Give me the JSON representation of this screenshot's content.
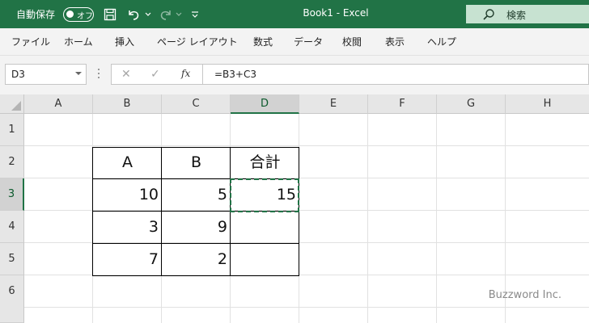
{
  "titlebar": {
    "autosave_label": "自動保存",
    "toggle_text": "オフ",
    "title": "Book1  -  Excel",
    "search_placeholder": "検索",
    "background": "#217346"
  },
  "ribbon": {
    "tabs": [
      "ファイル",
      "ホーム",
      "挿入",
      "ページ レイアウト",
      "数式",
      "データ",
      "校閲",
      "表示",
      "ヘルプ"
    ]
  },
  "formula_bar": {
    "name_box": "D3",
    "fx": "fx",
    "formula": "=B3+C3"
  },
  "grid": {
    "columns": [
      "A",
      "B",
      "C",
      "D",
      "E",
      "F",
      "G",
      "H"
    ],
    "rows": [
      "1",
      "2",
      "3",
      "4",
      "5",
      "6"
    ],
    "active_column": "D",
    "active_row": "3",
    "cells": {
      "B2": "A",
      "C2": "B",
      "D2": "合計",
      "B3": "10",
      "C3": "5",
      "D3": "15",
      "B4": "3",
      "C4": "9",
      "B5": "7",
      "C5": "2"
    }
  },
  "watermark": "Buzzword Inc."
}
